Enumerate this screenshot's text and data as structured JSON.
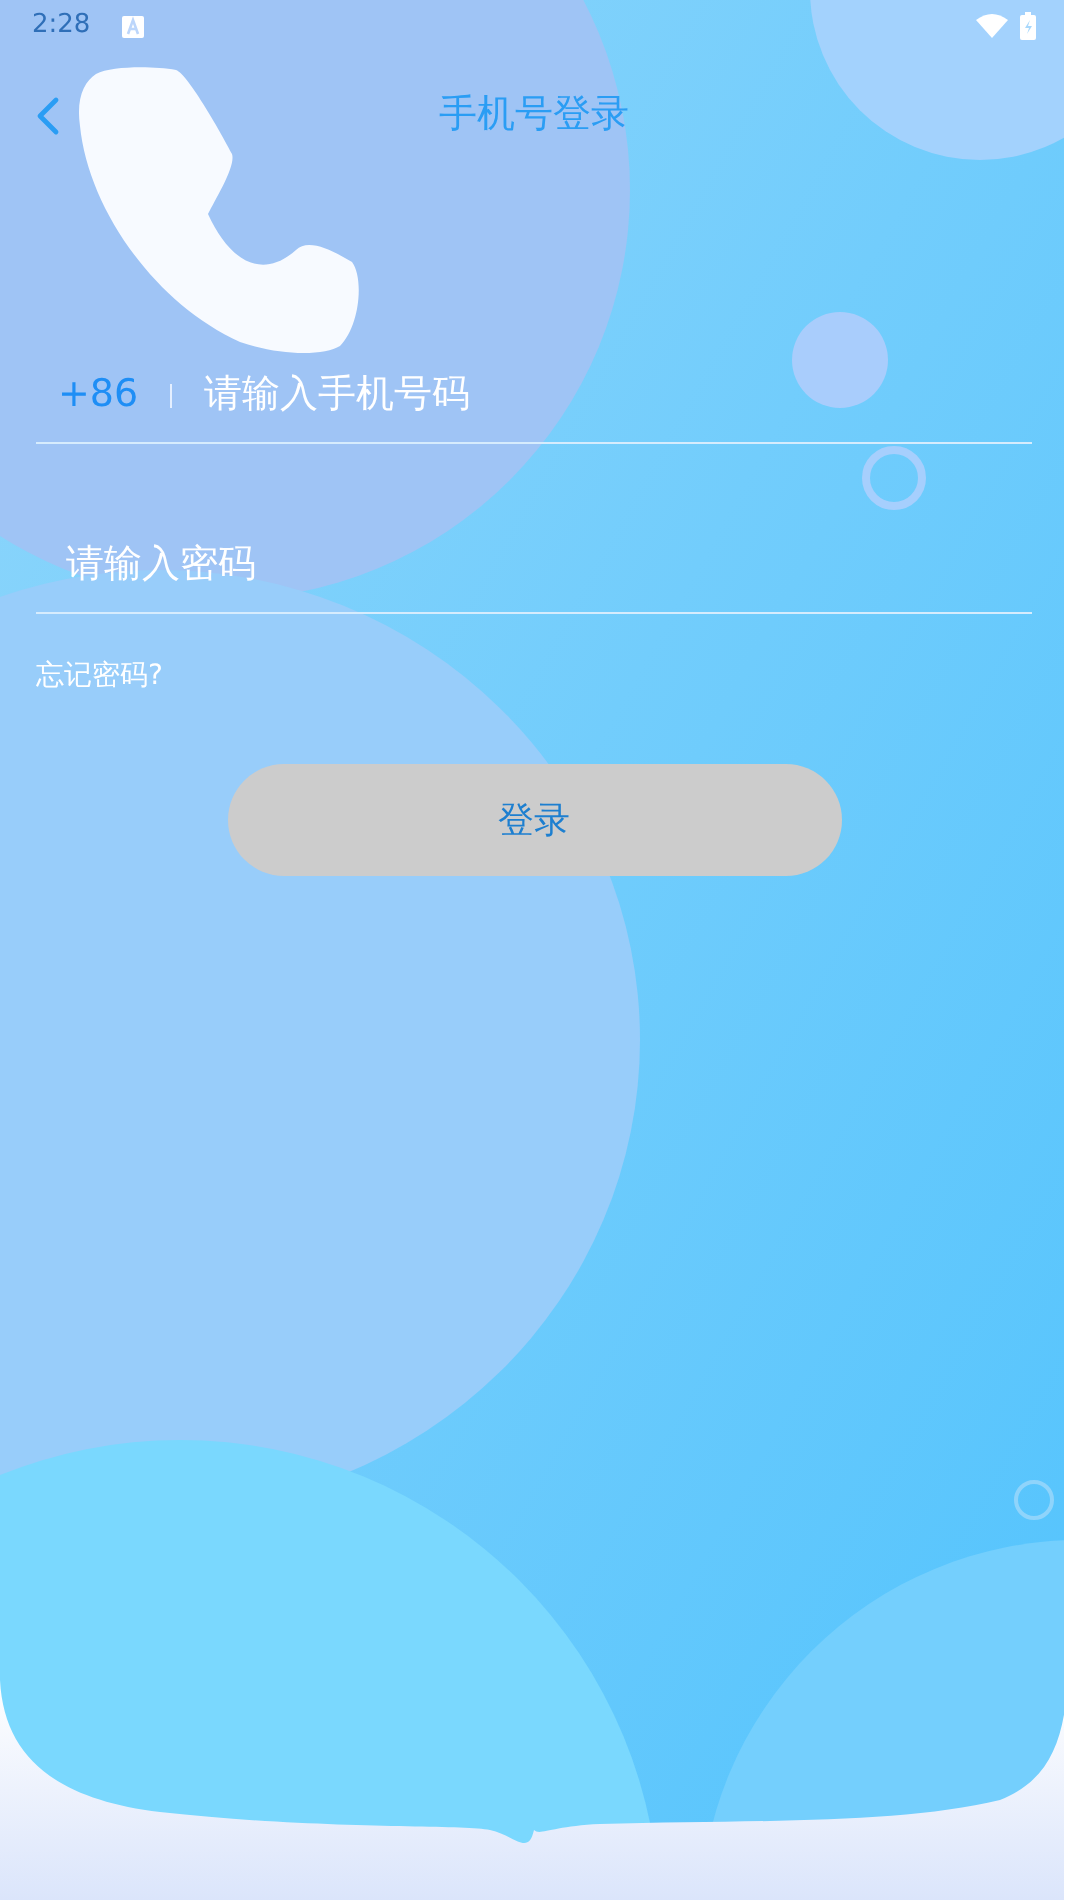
{
  "status_bar": {
    "time": "2:28"
  },
  "header": {
    "title": "手机号登录"
  },
  "phone_field": {
    "country_code": "+86",
    "placeholder": "请输入手机号码"
  },
  "password_field": {
    "placeholder": "请输入密码"
  },
  "forgot_link": "忘记密码?",
  "login_button": {
    "label": "登录",
    "disabled": true
  }
}
